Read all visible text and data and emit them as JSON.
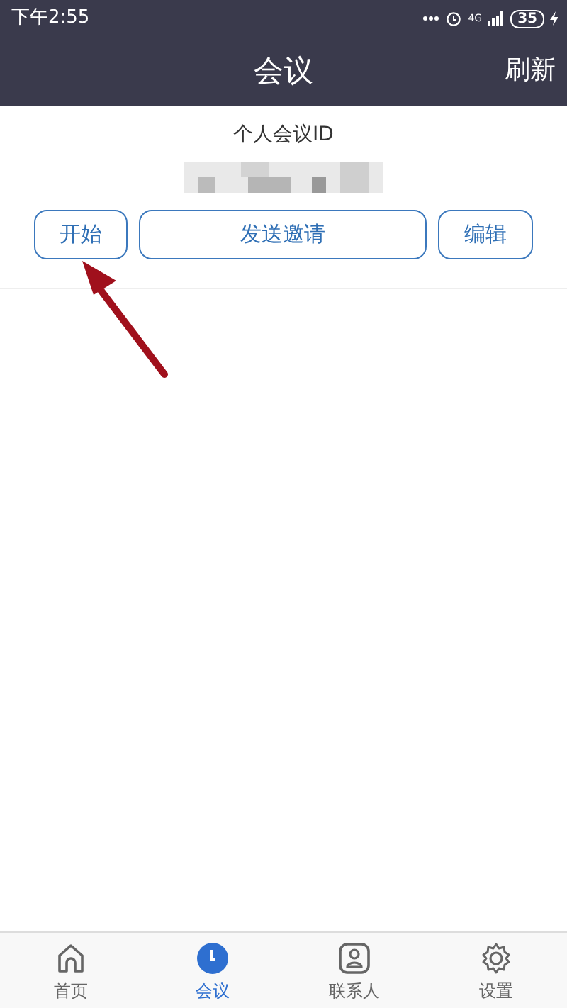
{
  "status_bar": {
    "time": "下午2:55",
    "network": "4G",
    "battery": "35"
  },
  "header": {
    "title": "会议",
    "action": "刷新"
  },
  "meeting": {
    "label": "个人会议ID",
    "buttons": [
      "开始",
      "发送邀请",
      "编辑"
    ]
  },
  "tabs": [
    {
      "label": "首页",
      "kind": "home",
      "selected": false
    },
    {
      "label": "会议",
      "kind": "clock",
      "selected": true
    },
    {
      "label": "联系人",
      "kind": "contact",
      "selected": false
    },
    {
      "label": "设置",
      "kind": "gear",
      "selected": false
    }
  ]
}
